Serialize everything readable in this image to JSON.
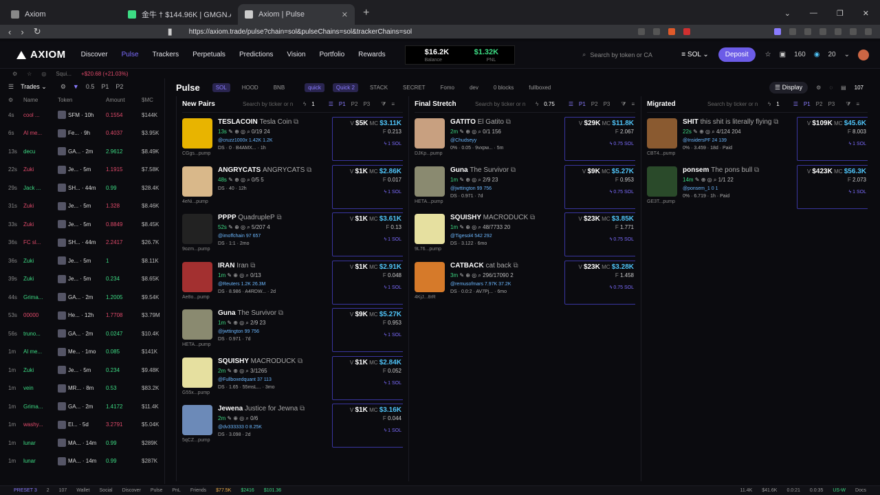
{
  "browser": {
    "tabs": [
      {
        "title": "Axiom",
        "color": "#888888"
      },
      {
        "title": "金牛 † $144.96K | GMGN.AI | The Fas",
        "color": "#3ddc84"
      },
      {
        "title": "Axiom | Pulse",
        "color": "#cccccc"
      }
    ],
    "url": "https://axiom.trade/pulse?chain=sol&pulseChains=sol&trackerChains=sol"
  },
  "header": {
    "logo": "AXIOM",
    "nav": [
      "Discover",
      "Pulse",
      "Trackers",
      "Perpetuals",
      "Predictions",
      "Vision",
      "Portfolio",
      "Rewards"
    ],
    "balance_value": "$16.2K",
    "pnl_value": "$1.32K",
    "balance_label": "Balance",
    "pnl_label": "PNL",
    "search_placeholder": "Search by token or CA",
    "chain": "SOL",
    "deposit": "Deposit",
    "count1": "160",
    "count2": "20"
  },
  "substrip": {
    "wallet": "Squi...",
    "gain": "+$20.68 (+21.03%)"
  },
  "trades": {
    "title": "Trades",
    "filter": "0.5",
    "presets": [
      "P1",
      "P2"
    ],
    "headers": [
      "Age",
      "Name",
      "Token",
      "Amount",
      "$MC"
    ],
    "rows": [
      {
        "t": "4s",
        "name": "cool ...",
        "tok": "SFM · 10h",
        "amt": "0.1554",
        "mc": "$144K",
        "side": "sell"
      },
      {
        "t": "6s",
        "name": "Al me...",
        "tok": "Fe... · 9h",
        "amt": "0.4037",
        "mc": "$3.95K",
        "side": "sell"
      },
      {
        "t": "13s",
        "name": "decu",
        "tok": "GA... · 2m",
        "amt": "2.9612",
        "mc": "$8.49K",
        "side": "buy"
      },
      {
        "t": "22s",
        "name": "Zuki",
        "tok": "Je... · 5m",
        "amt": "1.1915",
        "mc": "$7.58K",
        "side": "sell"
      },
      {
        "t": "29s",
        "name": "Jack ...",
        "tok": "SH... · 44m",
        "amt": "0.99",
        "mc": "$28.4K",
        "side": "buy"
      },
      {
        "t": "31s",
        "name": "Zuki",
        "tok": "Je... · 5m",
        "amt": "1.328",
        "mc": "$8.46K",
        "side": "sell"
      },
      {
        "t": "33s",
        "name": "Zuki",
        "tok": "Je... · 5m",
        "amt": "0.8849",
        "mc": "$8.45K",
        "side": "sell"
      },
      {
        "t": "36s",
        "name": "FC sl...",
        "tok": "SH... · 44m",
        "amt": "2.2417",
        "mc": "$26.7K",
        "side": "sell"
      },
      {
        "t": "36s",
        "name": "Zuki",
        "tok": "Je... · 5m",
        "amt": "1",
        "mc": "$8.11K",
        "side": "buy"
      },
      {
        "t": "39s",
        "name": "Zuki",
        "tok": "Je... · 5m",
        "amt": "0.234",
        "mc": "$8.65K",
        "side": "buy"
      },
      {
        "t": "44s",
        "name": "Grima...",
        "tok": "GA... · 2m",
        "amt": "1.2005",
        "mc": "$9.54K",
        "side": "buy"
      },
      {
        "t": "53s",
        "name": "00000",
        "tok": "He... · 12h",
        "amt": "1.7708",
        "mc": "$3.79M",
        "side": "sell"
      },
      {
        "t": "56s",
        "name": "truno...",
        "tok": "GA... · 2m",
        "amt": "0.0247",
        "mc": "$10.4K",
        "side": "buy"
      },
      {
        "t": "1m",
        "name": "Al me...",
        "tok": "Me... · 1mo",
        "amt": "0.085",
        "mc": "$141K",
        "side": "buy"
      },
      {
        "t": "1m",
        "name": "Zuki",
        "tok": "Je... · 5m",
        "amt": "0.234",
        "mc": "$9.48K",
        "side": "buy"
      },
      {
        "t": "1m",
        "name": "vein",
        "tok": "MR... · 8m",
        "amt": "0.53",
        "mc": "$83.2K",
        "side": "buy"
      },
      {
        "t": "1m",
        "name": "Grima...",
        "tok": "GA... · 2m",
        "amt": "1.4172",
        "mc": "$11.4K",
        "side": "buy"
      },
      {
        "t": "1m",
        "name": "washy...",
        "tok": "El... · 5d",
        "amt": "3.2791",
        "mc": "$5.04K",
        "side": "sell"
      },
      {
        "t": "1m",
        "name": "lunar",
        "tok": "MA... · 14m",
        "amt": "0.99",
        "mc": "$289K",
        "side": "buy"
      },
      {
        "t": "1m",
        "name": "lunar",
        "tok": "MA... · 14m",
        "amt": "0.99",
        "mc": "$287K",
        "side": "buy"
      }
    ]
  },
  "pulse": {
    "title": "Pulse",
    "chips": [
      "SOL",
      "HOOD",
      "BNB",
      "quick",
      "Quick 2",
      "STACK",
      "SECRET",
      "Fomo",
      "dev",
      "0 blocks",
      "fullboxed"
    ],
    "display": "Display",
    "count": "107",
    "columns": [
      {
        "title": "New Pairs",
        "filter": "1",
        "search": "Search by ticker or n",
        "cards": [
          {
            "ticker": "TESLACOIN",
            "name": "Tesla Coin",
            "age": "13s",
            "holders": "0/19",
            "extra": "24",
            "dev": "@cruzz1000x",
            "f1": "1.42K",
            "f2": "1.2K",
            "ds": "DS · 0 · B4AMX... · 1h",
            "thumb": "CGgs...pump",
            "v": "$5K",
            "mc": "$3.11K",
            "f": "0.213",
            "sol": "1 SOL",
            "color": "#e8b400"
          },
          {
            "ticker": "ANGRYCATS",
            "name": "ANGRYCATS",
            "age": "48s",
            "holders": "0/5",
            "extra": "5",
            "dev": "",
            "f1": "",
            "f2": "",
            "ds": "DS · 40 · 12h",
            "thumb": "4eNi...pump",
            "v": "$1K",
            "mc": "$2.86K",
            "f": "0.017",
            "sol": "1 SOL",
            "color": "#d9b88a"
          },
          {
            "ticker": "PPPP",
            "name": "QuadrupleP",
            "age": "52s",
            "holders": "5/207",
            "extra": "4",
            "dev": "@imoffchain",
            "f1": "97",
            "f2": "657",
            "ds": "DS · 1:1 · 2mo",
            "thumb": "9ozm...pump",
            "v": "$1K",
            "mc": "$3.61K",
            "f": "0.13",
            "sol": "1 SOL",
            "color": "#222222"
          },
          {
            "ticker": "IRAN",
            "name": "Iran",
            "age": "1m",
            "holders": "0/13",
            "extra": "",
            "dev": "@Reuters",
            "f1": "1.2K",
            "f2": "26.3M",
            "ds": "DS · 8.986 · A4RDW... · 2d",
            "thumb": "Ae8o...pump",
            "v": "$1K",
            "mc": "$2.91K",
            "f": "0.048",
            "sol": "1 SOL",
            "color": "#a33030"
          },
          {
            "ticker": "Guna",
            "name": "The Survivor",
            "age": "1m",
            "holders": "2/9",
            "extra": "23",
            "dev": "@jwttington",
            "f1": "99",
            "f2": "756",
            "ds": "DS · 0.971 · 7d",
            "thumb": "HETA...pump",
            "v": "$9K",
            "mc": "$5.27K",
            "f": "0.953",
            "sol": "1 SOL",
            "color": "#8a8a70"
          },
          {
            "ticker": "SQUISHY",
            "name": "MACRODUCK",
            "age": "2m",
            "holders": "3/1265",
            "extra": "",
            "dev": "@Fullboxedquant",
            "f1": "37",
            "f2": "113",
            "ds": "DS · 1.65 · 55msL... · 3mo",
            "thumb": "G55x...pump",
            "v": "$1K",
            "mc": "$2.84K",
            "f": "0.052",
            "sol": "1 SOL",
            "color": "#e6e0a0"
          },
          {
            "ticker": "Jewena",
            "name": "Justice for Jewna",
            "age": "2m",
            "holders": "0/6",
            "extra": "",
            "dev": "@dv333333",
            "f1": "0",
            "f2": "8.25K",
            "ds": "DS · 3.098 · 2d",
            "thumb": "5qCZ...pump",
            "v": "$1K",
            "mc": "$3.16K",
            "f": "0.044",
            "sol": "1 SOL",
            "color": "#6c8ab8"
          }
        ]
      },
      {
        "title": "Final Stretch",
        "filter": "0.75",
        "search": "Search by ticker or n",
        "cards": [
          {
            "ticker": "GATITO",
            "name": "El Gatito",
            "age": "2m",
            "holders": "0/1",
            "extra": "156",
            "dev": "@Chudseyy",
            "f1": "",
            "f2": "",
            "ds": "0% · 0.05 · 9vxpw... · 5m",
            "thumb": "DJKp...pump",
            "v": "$29K",
            "mc": "$11.8K",
            "f": "2.067",
            "sol": "0.75 SOL",
            "color": "#c8a080"
          },
          {
            "ticker": "Guna",
            "name": "The Survivor",
            "age": "1m",
            "holders": "2/9",
            "extra": "23",
            "dev": "@jwttington",
            "f1": "99",
            "f2": "756",
            "ds": "DS · 0.971 · 7d",
            "thumb": "HETA...pump",
            "v": "$9K",
            "mc": "$5.27K",
            "f": "0.953",
            "sol": "0.75 SOL",
            "color": "#8a8a70"
          },
          {
            "ticker": "SQUISHY",
            "name": "MACRODUCK",
            "age": "1m",
            "holders": "48/7733",
            "extra": "20",
            "dev": "@Tigesol4",
            "f1": "542",
            "f2": "292",
            "ds": "DS · 3.122 · 6mo",
            "thumb": "9L76...pump",
            "v": "$23K",
            "mc": "$3.85K",
            "f": "1.771",
            "sol": "0.75 SOL",
            "color": "#e6e0a0"
          },
          {
            "ticker": "CATBACK",
            "name": "cat back",
            "age": "3m",
            "holders": "296/17090",
            "extra": "2",
            "dev": "@remusofmars",
            "f1": "7.97K",
            "f2": "37.2K",
            "ds": "DS · 0.0:2 · AV7Pj... · 6mo",
            "thumb": "4KjJ...8rR",
            "v": "$23K",
            "mc": "$3.28K",
            "f": "1.458",
            "sol": "0.75 SOL",
            "color": "#d67a2a"
          }
        ]
      },
      {
        "title": "Migrated",
        "filter": "1",
        "search": "Search by ticker or n",
        "cards": [
          {
            "ticker": "SHIT",
            "name": "this shit is literally flying",
            "age": "22s",
            "holders": "4/124",
            "extra": "204",
            "dev": "@InsidersPF",
            "f1": "24",
            "f2": "139",
            "ds": "0% · 3.459 · 18d · Paid",
            "thumb": "CBT4...pump",
            "v": "$109K",
            "mc": "$45.6K",
            "f": "8.003",
            "sol": "1 SOL",
            "color": "#8a5a30"
          },
          {
            "ticker": "ponsem",
            "name": "The pons bull",
            "age": "14m",
            "holders": "1/1",
            "extra": "22",
            "dev": "@ponsem_1",
            "f1": "0",
            "f2": "1",
            "ds": "0% · 6.719 · 1h · Paid",
            "thumb": "GE3T...pump",
            "v": "$423K",
            "mc": "$56.3K",
            "f": "2.073",
            "sol": "1 SOL",
            "color": "#2a4a2a"
          }
        ]
      }
    ]
  },
  "statusbar": {
    "preset": "PRESET 3",
    "items": [
      "2",
      "107",
      "Wallet",
      "Social",
      "Discover",
      "Pulse",
      "PnL",
      "Friends"
    ],
    "amber": "$77.5K",
    "mid": "$2416",
    "green": "$101.36",
    "right": [
      "11.4K",
      "$41.6K",
      "0.0:21",
      "0.0:35",
      "US-W",
      "Docs"
    ]
  }
}
